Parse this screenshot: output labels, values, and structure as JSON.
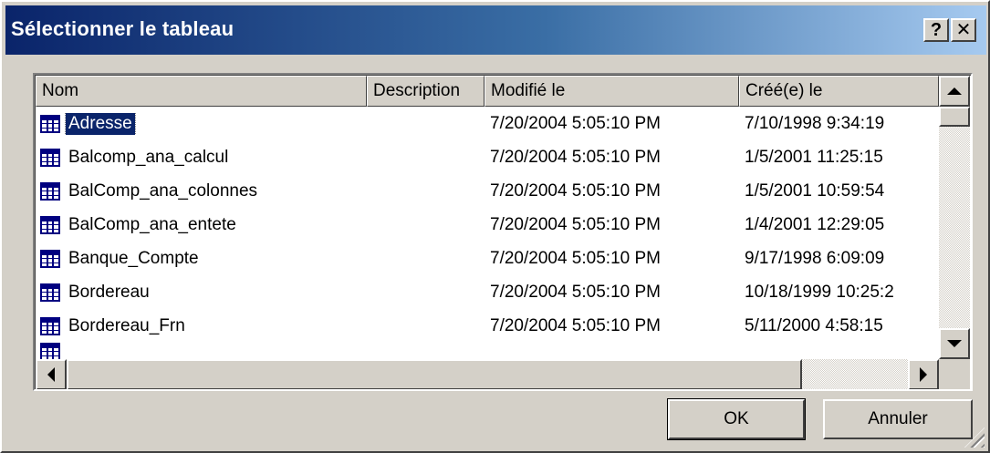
{
  "window": {
    "title": "Sélectionner le tableau",
    "help_label": "?",
    "close_label": "✕"
  },
  "listview": {
    "columns": [
      "Nom",
      "Description",
      "Modifié le",
      "Créé(e) le"
    ],
    "rows": [
      {
        "name": "Adresse",
        "description": "",
        "modified": "7/20/2004 5:05:10 PM",
        "created": "7/10/1998 9:34:19",
        "selected": true
      },
      {
        "name": "Balcomp_ana_calcul",
        "description": "",
        "modified": "7/20/2004 5:05:10 PM",
        "created": "1/5/2001 11:25:15"
      },
      {
        "name": "BalComp_ana_colonnes",
        "description": "",
        "modified": "7/20/2004 5:05:10 PM",
        "created": "1/5/2001 10:59:54"
      },
      {
        "name": "BalComp_ana_entete",
        "description": "",
        "modified": "7/20/2004 5:05:10 PM",
        "created": "1/4/2001 12:29:05"
      },
      {
        "name": "Banque_Compte",
        "description": "",
        "modified": "7/20/2004 5:05:10 PM",
        "created": "9/17/1998 6:09:09"
      },
      {
        "name": "Bordereau",
        "description": "",
        "modified": "7/20/2004 5:05:10 PM",
        "created": "10/18/1999 10:25:2"
      },
      {
        "name": "Bordereau_Frn",
        "description": "",
        "modified": "7/20/2004 5:05:10 PM",
        "created": "5/11/2000 4:58:15"
      }
    ],
    "row_icon": "table-icon"
  },
  "buttons": {
    "ok_label": "OK",
    "cancel_label": "Annuler"
  },
  "colors": {
    "titlebar_start": "#0a246a",
    "titlebar_end": "#a6caf0",
    "selection": "#0a246a",
    "face": "#d4d0c8"
  }
}
